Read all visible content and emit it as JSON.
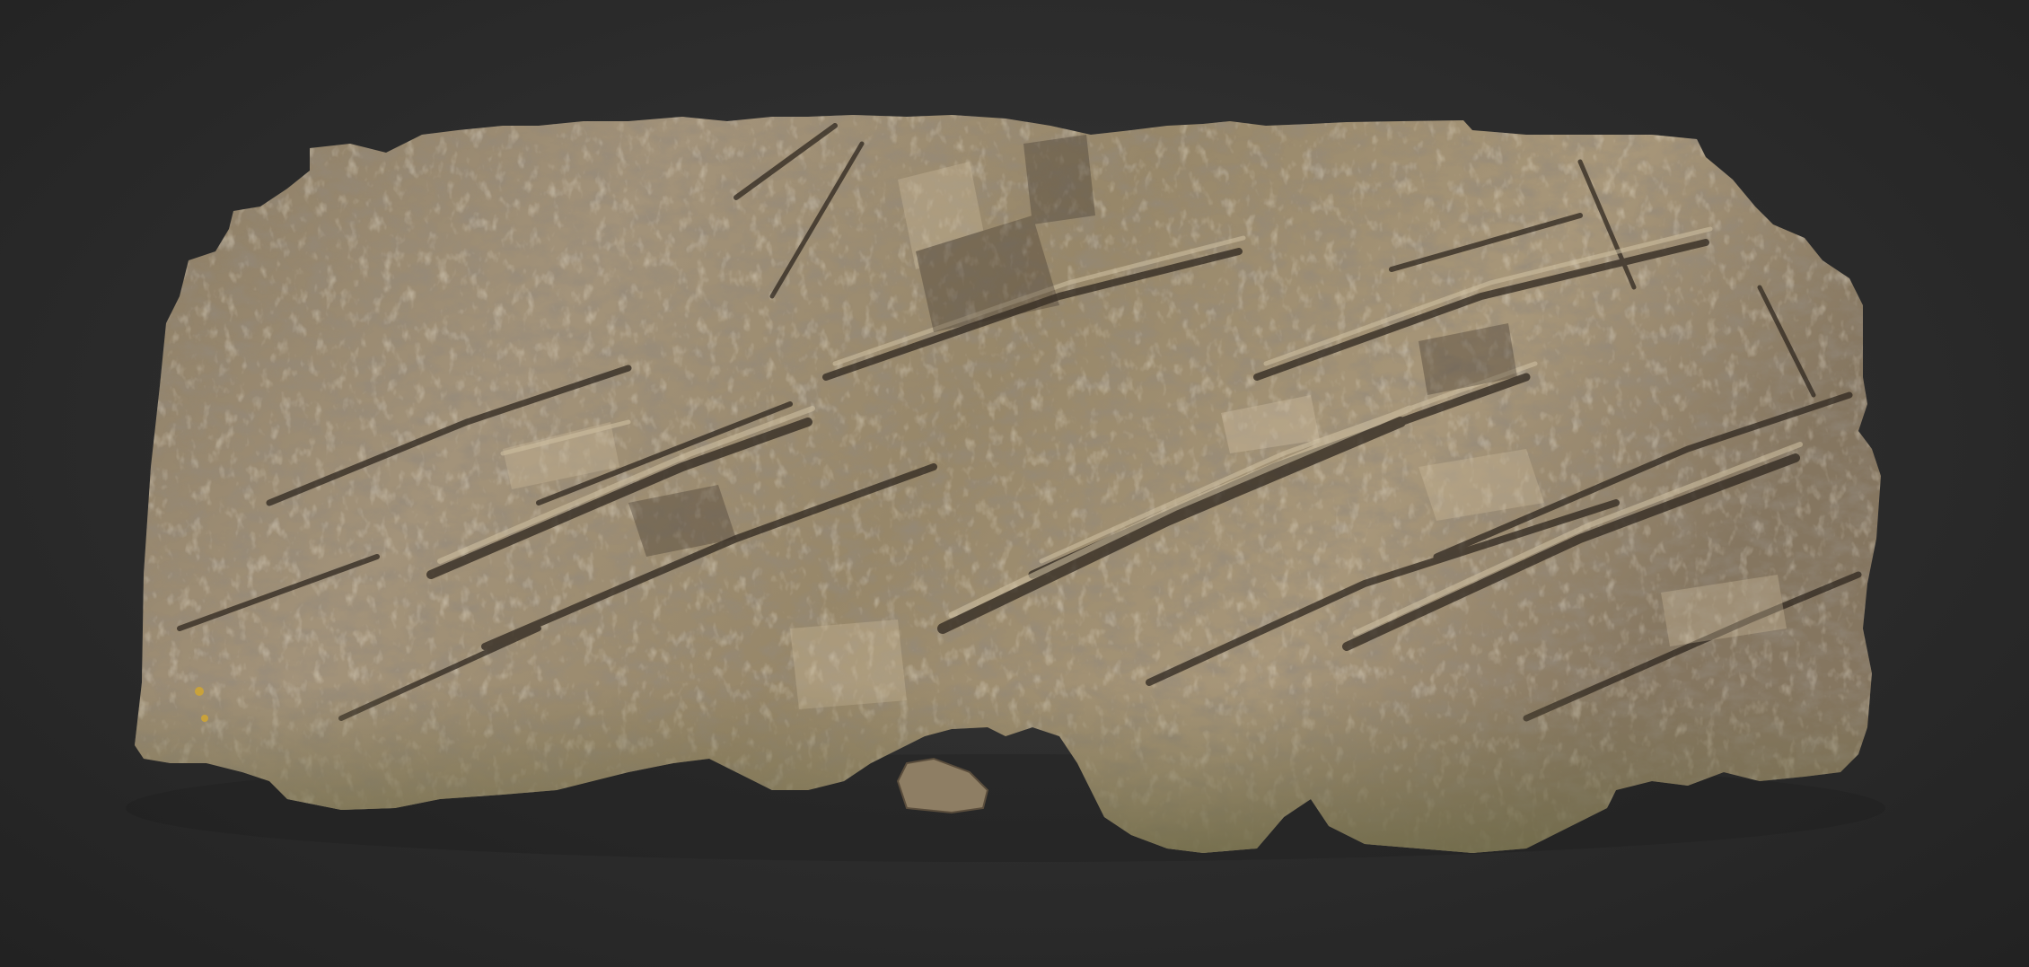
{
  "scene": {
    "subject": "rock-cliff-scan",
    "colors": {
      "background_center": "#3a3a3a",
      "background_edge": "#222222",
      "rock_light": "#b9a98c",
      "rock_mid": "#8c7c62",
      "rock_dark": "#4a4034",
      "rock_shadow": "#2a231c",
      "grass": "#6f6a48",
      "lichen": "#c9a23a"
    }
  }
}
